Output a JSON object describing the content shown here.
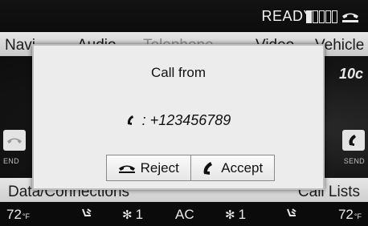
{
  "status": {
    "ready_label": "READY",
    "battery_cells_filled": 1,
    "battery_cells_total": 5
  },
  "nav": {
    "items": [
      "Navi",
      "Audio",
      "Telephone",
      "Video",
      "Vehicle"
    ]
  },
  "background_fragment": "10c",
  "side": {
    "end_label": "END",
    "send_label": "SEND"
  },
  "bottom_bar": {
    "left": "Data/Connections",
    "right": "Call Lists"
  },
  "climate": {
    "left_temp": "72",
    "right_temp": "72",
    "unit": "°F",
    "left_fan": "1",
    "ac_label": "AC",
    "right_fan": "1"
  },
  "dialog": {
    "title": "Call from",
    "separator": ":",
    "number": "+123456789",
    "reject_label": "Reject",
    "accept_label": "Accept"
  }
}
